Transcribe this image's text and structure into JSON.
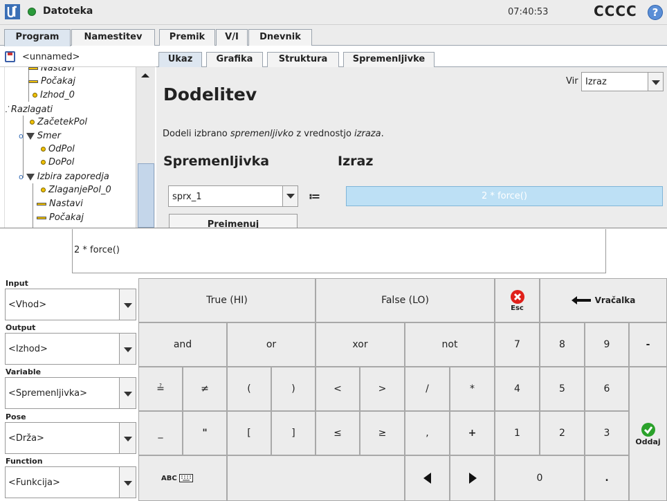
{
  "header": {
    "title": "Datoteka",
    "clock": "07:40:53",
    "robot_name": "CCCC",
    "help_glyph": "?"
  },
  "main_tabs": [
    "Program",
    "Namestitev",
    "Premik",
    "V/I",
    "Dnevnik"
  ],
  "program": {
    "file_name": "<unnamed>",
    "tree": [
      {
        "label": "Nastavi",
        "marker": "dash"
      },
      {
        "label": "Počakaj",
        "marker": "dash"
      },
      {
        "label": "Izhod_0",
        "marker": "dot"
      },
      {
        "label": "Razlagati",
        "marker": "fork"
      },
      {
        "label": "ZačetekPol",
        "marker": "dot"
      },
      {
        "label": "Smer",
        "marker": "triangle"
      },
      {
        "label": "OdPol",
        "marker": "dot"
      },
      {
        "label": "DoPol",
        "marker": "dot"
      },
      {
        "label": "Izbira zaporedja",
        "marker": "triangle"
      },
      {
        "label": "ZlaganjePol_0",
        "marker": "dot"
      },
      {
        "label": "Nastavi",
        "marker": "dash"
      },
      {
        "label": "Počakaj",
        "marker": "dash"
      }
    ]
  },
  "sub_tabs": [
    "Ukaz",
    "Grafika",
    "Struktura",
    "Spremenljivke"
  ],
  "command": {
    "source_label": "Vir",
    "source_value": "Izraz",
    "heading": "Dodelitev",
    "desc_1": "Dodeli izbrano ",
    "desc_var": "spremenljivko",
    "desc_2": " z vrednostjo ",
    "desc_expr": "izraza",
    "desc_3": ".",
    "var_header": "Spremenljivka",
    "expr_header": "Izraz",
    "variable": "sprx_1",
    "assign_op": "≔",
    "expression": "2 * force()",
    "rename_label": "Preimenuj"
  },
  "keyboard": {
    "input_text": "2 * force()",
    "sections": [
      {
        "label": "Input",
        "value": "<Vhod>"
      },
      {
        "label": "Output",
        "value": "<Izhod>"
      },
      {
        "label": "Variable",
        "value": "<Spremenljivka>"
      },
      {
        "label": "Pose",
        "value": "<Drža>"
      },
      {
        "label": "Function",
        "value": "<Funkcija>"
      }
    ],
    "keys": {
      "true": "True (HI)",
      "false": "False (LO)",
      "esc": "Esc",
      "backspace": "Vračalka",
      "and": "and",
      "or": "or",
      "xor": "xor",
      "not": "not",
      "eq": "≟",
      "neq": "≠",
      "lparen": "(",
      "rparen": ")",
      "lt": "<",
      "gt": ">",
      "slash": "/",
      "star": "*",
      "underscore": "_",
      "quote": "\"",
      "lbracket": "[",
      "rbracket": "]",
      "le": "≤",
      "ge": "≥",
      "comma": ",",
      "plus": "+",
      "abc": "ABC",
      "n7": "7",
      "n8": "8",
      "n9": "9",
      "minus": "-",
      "n4": "4",
      "n5": "5",
      "n6": "6",
      "n1": "1",
      "n2": "2",
      "n3": "3",
      "n0": "0",
      "dot": ".",
      "submit": "Oddaj"
    }
  }
}
